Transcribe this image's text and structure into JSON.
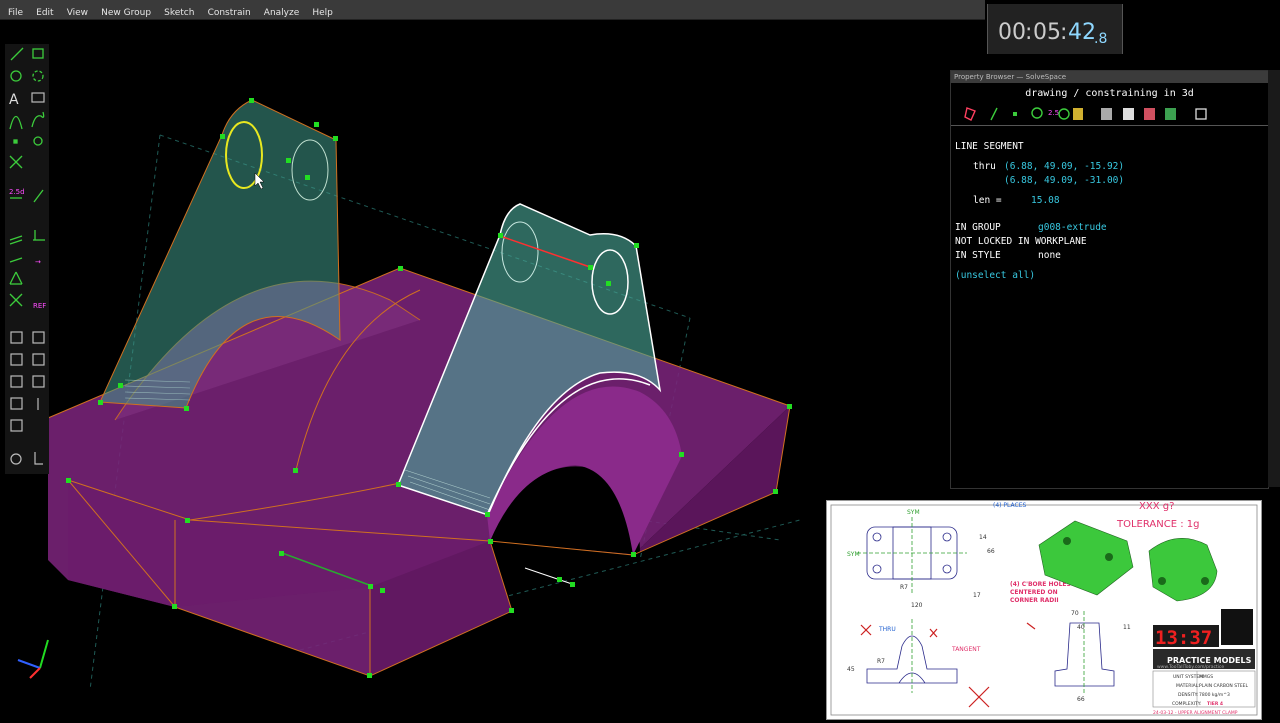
{
  "menu": [
    "File",
    "Edit",
    "View",
    "New Group",
    "Sketch",
    "Constrain",
    "Analyze",
    "Help"
  ],
  "timer": {
    "hh": "00",
    "mm": "05",
    "ss": "42",
    "frac": ".8"
  },
  "property_browser": {
    "title": "Property Browser — SolveSpace",
    "header": "drawing / constraining in 3d",
    "entity_type": "LINE SEGMENT",
    "thru_label": "thru",
    "p1": "(6.88, 49.09, -15.92)",
    "p2": "(6.88, 49.09, -31.00)",
    "len_label": "len = ",
    "len_value": "15.08",
    "in_group_label": "IN GROUP",
    "in_group_value": "g008-extrude",
    "locked": "NOT LOCKED IN WORKPLANE",
    "in_style_label": "IN STYLE",
    "in_style_value": "none",
    "unselect": "(unselect all)"
  },
  "toolbar_tools": [
    "line-tool",
    "rectangle-tool",
    "circle-tool",
    "arc-tool",
    "text-tool",
    "image-tool",
    "spline-tool",
    "tangent-arc-tool",
    "point-tool",
    "construction-tool",
    "split-tool",
    "distance-constraint",
    "angle-constraint",
    "horizontal-constraint",
    "vertical-constraint",
    "parallel-constraint",
    "perpendicular-constraint",
    "on-point-constraint",
    "symmetric-constraint",
    "equal-constraint",
    "midpoint-constraint",
    "ref-constraint",
    "workplane-tool",
    "step-translate-tool",
    "step-rotate-tool",
    "extrude-tool",
    "lathe-tool",
    "revolve-tool",
    "helix-tool",
    "link-tool",
    "nearest-view-tool",
    "ortho-view-tool"
  ],
  "reference_sheet": {
    "title": "XXX g?",
    "tolerance": "TOLERANCE : 1g",
    "places": "(4) PLACES",
    "cbore": [
      "(4) C'BORE HOLES",
      "CENTERED ON",
      "CORNER RADII"
    ],
    "tangent": "TANGENT",
    "thru": "THRU",
    "sym": "SYM",
    "dims": [
      "R7",
      "120",
      "14",
      "66",
      "17",
      "70",
      "40",
      "11",
      "66",
      "45",
      "R7"
    ],
    "clock": "13:37",
    "brand": "PRACTICE MODELS",
    "url": "www.TooTallToby.com/practice",
    "table": [
      [
        "UNIT SYSTEM:",
        "MMGS"
      ],
      [
        "MATERIAL:",
        "PLAIN CARBON STEEL"
      ],
      [
        "DENSITY:",
        "7800 kg/m^3"
      ],
      [
        "COMPLEXITY:",
        "TIER 4"
      ]
    ],
    "part_name": "24-03-12 - UPPER ALIGNMENT CLAMP"
  },
  "colors": {
    "accent": "#38c8e0",
    "body": "#8a2a8a",
    "bracket": "#3f9a8a",
    "point": "#22dd22",
    "edge": "#d07020"
  }
}
